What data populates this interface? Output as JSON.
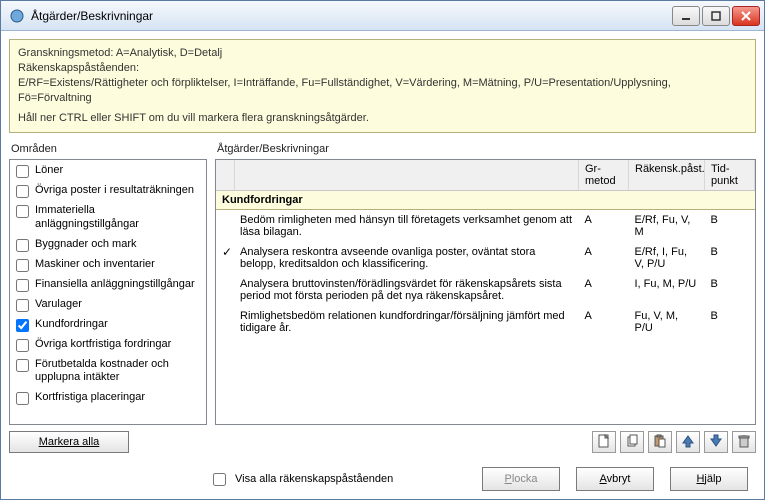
{
  "window": {
    "title": "Åtgärder/Beskrivningar"
  },
  "info": {
    "line1": "Granskningsmetod: A=Analytisk, D=Detalj",
    "line2": "Räkenskapspåståenden:",
    "line3": "E/RF=Existens/Rättigheter och förpliktelser, I=Inträffande, Fu=Fullständighet, V=Värdering, M=Mätning, P/U=Presentation/Upplysning, Fö=Förvaltning",
    "line4": "Håll ner CTRL eller SHIFT om du vill markera flera granskningsåtgärder."
  },
  "areas": {
    "title": "Områden",
    "mark_all": "Markera alla",
    "items": [
      {
        "label": "Löner",
        "checked": false
      },
      {
        "label": "Övriga poster i resultaträkningen",
        "checked": false
      },
      {
        "label": "Immateriella anläggningstillgångar",
        "checked": false
      },
      {
        "label": "Byggnader och mark",
        "checked": false
      },
      {
        "label": "Maskiner och inventarier",
        "checked": false
      },
      {
        "label": "Finansiella anläggningstillgångar",
        "checked": false
      },
      {
        "label": "Varulager",
        "checked": false
      },
      {
        "label": "Kundfordringar",
        "checked": true
      },
      {
        "label": "Övriga kortfristiga fordringar",
        "checked": false
      },
      {
        "label": "Förutbetalda kostnader och upplupna intäkter",
        "checked": false
      },
      {
        "label": "Kortfristiga placeringar",
        "checked": false
      }
    ]
  },
  "grid": {
    "title": "Åtgärder/Beskrivningar",
    "headers": {
      "desc": "",
      "method": "Gr-metod",
      "assert": "Räkensk.påst.",
      "time": "Tid-punkt"
    },
    "section": "Kundfordringar",
    "rows": [
      {
        "checked": false,
        "desc": "Bedöm rimligheten med hänsyn till företagets verksamhet genom att läsa bilagan.",
        "method": "A",
        "assert": "E/Rf, Fu, V, M",
        "time": "B"
      },
      {
        "checked": true,
        "desc": "Analysera reskontra avseende ovanliga poster, oväntat stora belopp, kreditsaldon och klassificering.",
        "method": "A",
        "assert": "E/Rf, I, Fu, V, P/U",
        "time": "B"
      },
      {
        "checked": false,
        "desc": "Analysera bruttovinsten/förädlingsvärdet för räkenskapsårets sista period mot första perioden på det nya räkenskapsåret.",
        "method": "A",
        "assert": "I, Fu, M, P/U",
        "time": "B"
      },
      {
        "checked": false,
        "desc": "Rimlighetsbedöm relationen kundfordringar/försäljning jämfört med tidigare år.",
        "method": "A",
        "assert": "Fu, V, M, P/U",
        "time": "B"
      }
    ]
  },
  "toolbar": {
    "new": "new-icon",
    "copy": "copy-icon",
    "paste": "paste-icon",
    "up": "arrow-up-icon",
    "down": "arrow-down-icon",
    "delete": "trash-icon"
  },
  "bottom": {
    "show_all": "Visa alla räkenskapspåståenden",
    "pick": "Plocka",
    "cancel": "Avbryt",
    "help": "Hjälp"
  }
}
